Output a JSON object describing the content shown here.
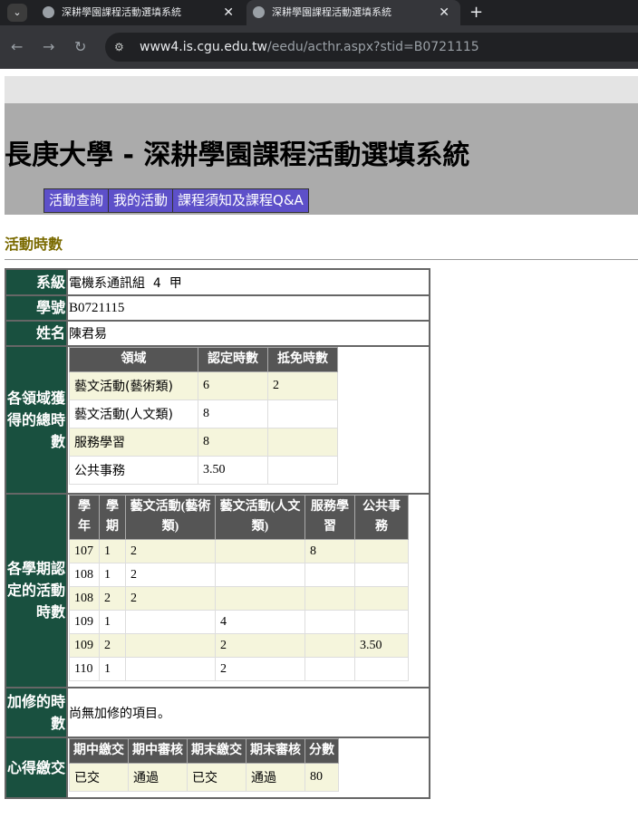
{
  "browser": {
    "tabs": [
      {
        "title": "深耕學園課程活動選填系統"
      },
      {
        "title": "深耕學園課程活動選填系統"
      }
    ],
    "url_host": "www4.is.cgu.edu.tw",
    "url_path": "/eedu/acthr.aspx?stid=B0721115"
  },
  "header": {
    "title": "長庚大學 - 深耕學園課程活動選填系統",
    "menu": [
      "活動查詢",
      "我的活動",
      "課程須知及課程Q&A"
    ]
  },
  "section_title": "活動時數",
  "student": {
    "dept_label": "系級",
    "dept_value": "電機系通訊組  4  甲",
    "id_label": "學號",
    "id_value": "B0721115",
    "name_label": "姓名",
    "name_value": "陳君易"
  },
  "domain_hours": {
    "label": "各領域獲得的總時數",
    "headers": [
      "領域",
      "認定時數",
      "抵免時數"
    ],
    "rows": [
      [
        "藝文活動(藝術類)",
        "6",
        "2"
      ],
      [
        "藝文活動(人文類)",
        "8",
        ""
      ],
      [
        "服務學習",
        "8",
        ""
      ],
      [
        "公共事務",
        "3.50",
        ""
      ]
    ]
  },
  "semester_hours": {
    "label": "各學期認定的活動時數",
    "headers": [
      "學年",
      "學期",
      "藝文活動(藝術類)",
      "藝文活動(人文類)",
      "服務學習",
      "公共事務"
    ],
    "rows": [
      [
        "107",
        "1",
        "2",
        "",
        "8",
        ""
      ],
      [
        "108",
        "1",
        "2",
        "",
        "",
        ""
      ],
      [
        "108",
        "2",
        "2",
        "",
        "",
        ""
      ],
      [
        "109",
        "1",
        "",
        "4",
        "",
        ""
      ],
      [
        "109",
        "2",
        "",
        "2",
        "",
        "3.50"
      ],
      [
        "110",
        "1",
        "",
        "2",
        "",
        ""
      ]
    ]
  },
  "extra_hours": {
    "label": "加修的時數",
    "value": "尚無加修的項目。"
  },
  "reflection": {
    "label": "心得繳交",
    "headers": [
      "期中繳交",
      "期中審核",
      "期末繳交",
      "期末審核",
      "分數"
    ],
    "row": [
      "已交",
      "通過",
      "已交",
      "通過",
      "80"
    ]
  }
}
